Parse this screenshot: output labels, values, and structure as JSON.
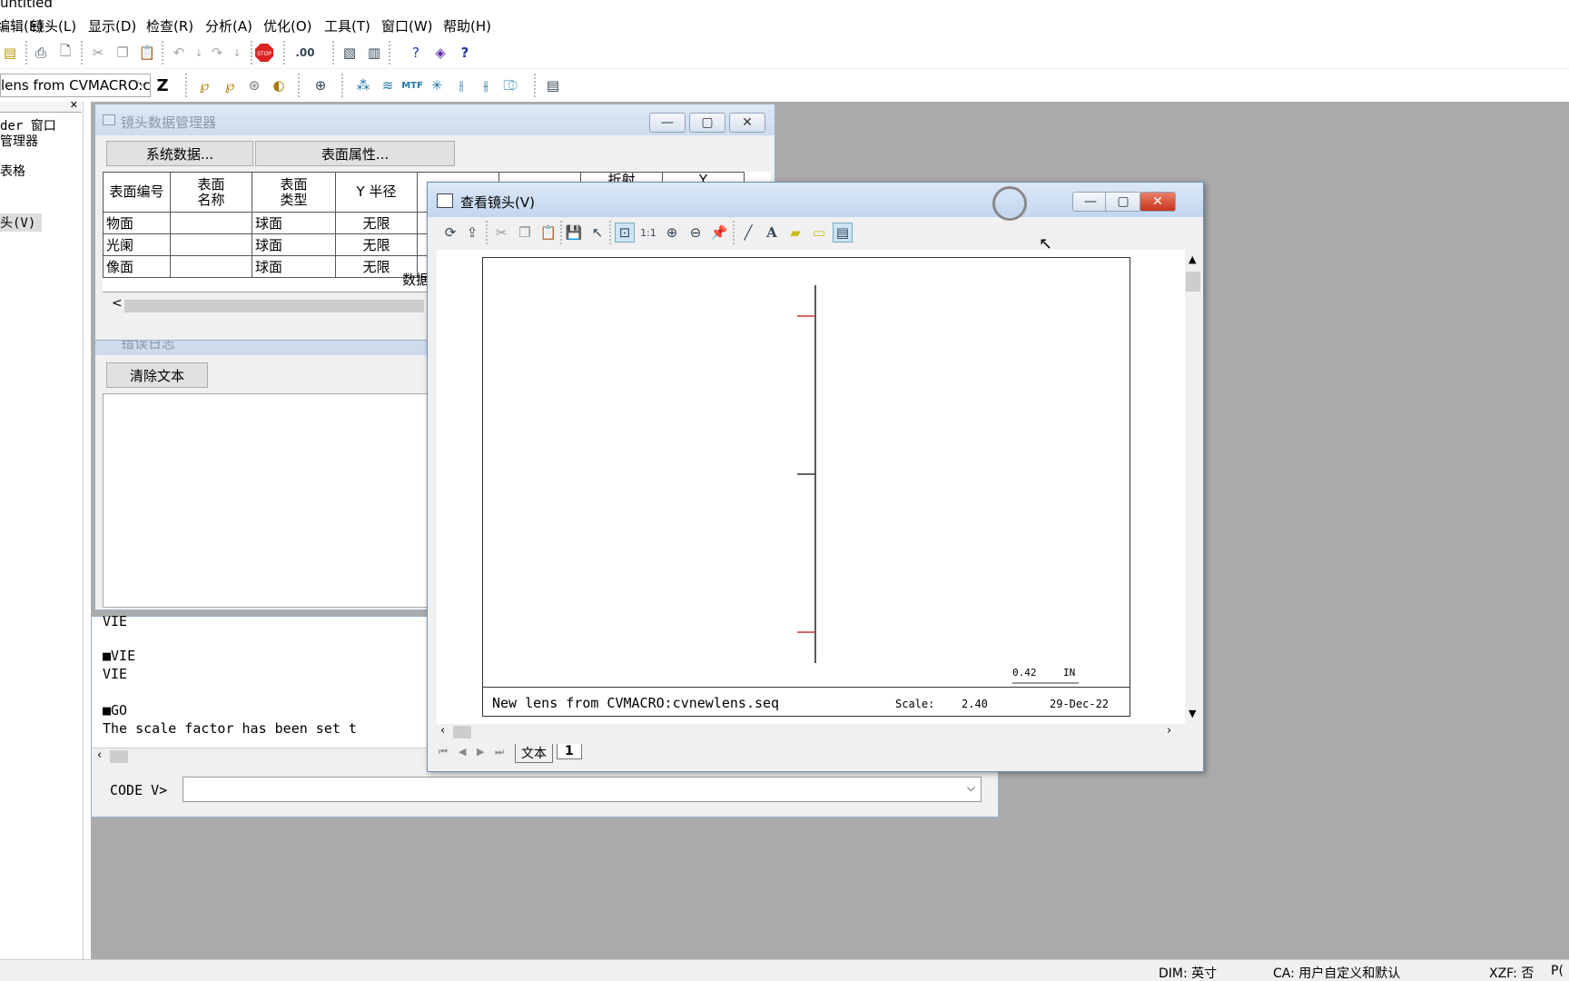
{
  "app": {
    "title": "untitled"
  },
  "menu": [
    "编辑(E)",
    "镜头(L)",
    "显示(D)",
    "检查(R)",
    "分析(A)",
    "优化(O)",
    "工具(T)",
    "窗口(W)",
    "帮助(H)"
  ],
  "toolbar": {
    "macro_combo": "lens from CVMACRO:c",
    "z_label": "Z",
    "icons": [
      "new-icon",
      "print-icon",
      "print-preview-icon",
      "cut-icon",
      "copy-icon",
      "paste-icon",
      "undo-icon",
      "redo-icon",
      "stop-icon",
      "decimal-icon",
      "chart-icon",
      "layout-icon",
      "help-icon",
      "book-icon",
      "whats-this-icon",
      "ray-fan-yz-icon",
      "ray-fan-xz-icon",
      "spot-icon",
      "lens-icon",
      "focus-icon",
      "spot-diagram-icon",
      "field-curve-icon",
      "mtf-icon",
      "star-icon",
      "through-focus-icon",
      "field-icon",
      "psf-icon",
      "report-icon"
    ]
  },
  "left_pane": {
    "lines": [
      "der 窗口",
      "管理器",
      "",
      "表格",
      "",
      "头(V)"
    ]
  },
  "lens_manager": {
    "title": "镜头数据管理器",
    "system_button": "系统数据...",
    "surface_button": "表面属性...",
    "columns": [
      "表面编号",
      "表面\n名称",
      "表面\n类型",
      "Y 半径",
      "",
      "",
      "折射",
      "Y"
    ],
    "rows": [
      [
        "物面",
        "",
        "球面",
        "无限"
      ],
      [
        "光阑",
        "",
        "球面",
        "无限"
      ],
      [
        "像面",
        "",
        "球面",
        "无限"
      ]
    ],
    "footer": "数据",
    "scroll_left": "<"
  },
  "error_log": {
    "title": "错误日志",
    "clear_button": "清除文本"
  },
  "command_window": {
    "lines": [
      {
        "marker": "",
        "text": "    VIE"
      },
      {
        "marker": "■",
        "text": "VIE"
      },
      {
        "marker": "",
        "text": "    VIE"
      },
      {
        "marker": "■",
        "text": "GO"
      },
      {
        "marker": "",
        "text": "    The scale factor has been set t"
      }
    ],
    "prompt": "CODE V>",
    "input_value": ""
  },
  "lens_view": {
    "title": "查看镜头(V)",
    "caption": "New lens from CVMACRO:cvnewlens.seq",
    "scale_label": "Scale:",
    "scale_value": "2.40",
    "date": "29-Dec-22",
    "scale_bar_value": "0.42",
    "scale_bar_unit": "IN",
    "tabs": [
      "文本",
      "1"
    ]
  },
  "status": {
    "dim": "DIM: 英寸",
    "ca": "CA: 用户自定义和默认",
    "xzf": "XZF: 否",
    "extra": "P("
  }
}
